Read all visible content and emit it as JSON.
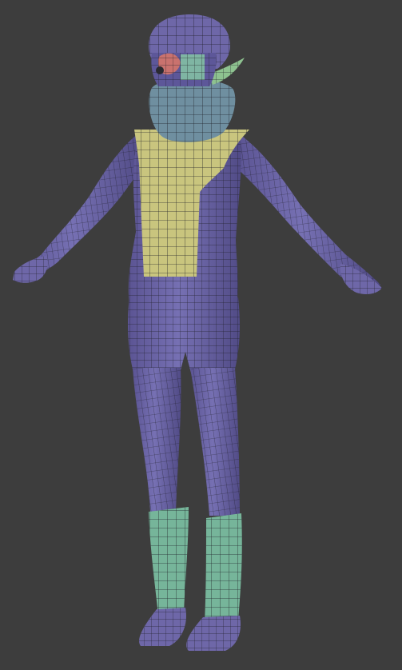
{
  "viewport": {
    "background": "#3d3d3d",
    "subject": "3d-character-wireframe"
  },
  "materials": {
    "body": "#6e67a8",
    "body_shade": "#544e8a",
    "torso_panel": "#c9c57e",
    "scarf": "#6f8fa0",
    "boots": "#76b59a",
    "helmet": "#6e67a8",
    "ear": "#8ec290",
    "face_accent": "#c9726e",
    "wire": "#1b1b22"
  }
}
